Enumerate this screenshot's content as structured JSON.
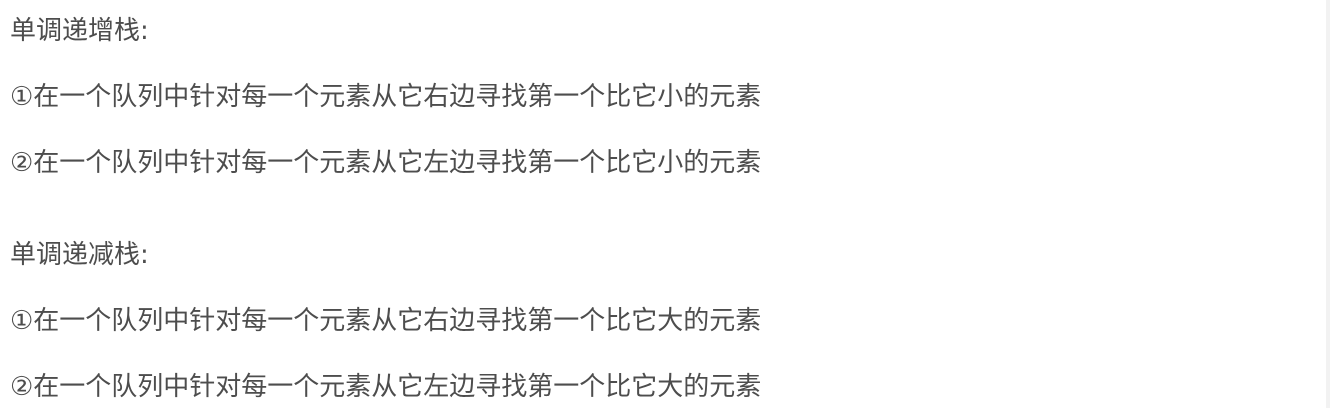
{
  "increasing_stack": {
    "heading": "单调递增栈:",
    "item_1": "①在一个队列中针对每一个元素从它右边寻找第一个比它小的元素",
    "item_2": "②在一个队列中针对每一个元素从它左边寻找第一个比它小的元素"
  },
  "decreasing_stack": {
    "heading": "单调递减栈:",
    "item_1": "①在一个队列中针对每一个元素从它右边寻找第一个比它大的元素",
    "item_2": "②在一个队列中针对每一个元素从它左边寻找第一个比它大的元素"
  }
}
